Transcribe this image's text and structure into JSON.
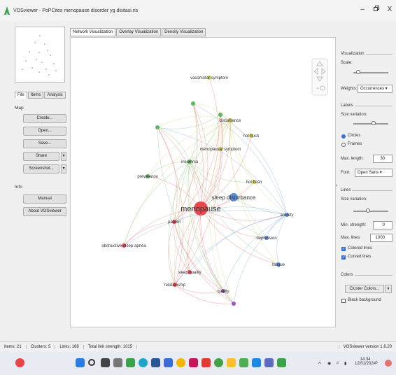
{
  "window": {
    "title": "VOSviewer - PoPCites menopause disorder yg disitasi.ris",
    "minimize": "–",
    "maximize": "料",
    "close": "X"
  },
  "left_panel": {
    "tabs": [
      "File",
      "Items",
      "Analysis"
    ],
    "map_label": "Map",
    "buttons": [
      "Create...",
      "Open...",
      "Save...",
      "Share",
      "Screenshot..."
    ],
    "info_label": "Info",
    "info_buttons": [
      "Manual",
      "About VOSviewer"
    ]
  },
  "main_tabs": [
    "Network Visualization",
    "Overlay Visualization",
    "Density Visualization"
  ],
  "right_panel": {
    "visualization": "Visualization",
    "scale": "Scale:",
    "weights_label": "Weights:",
    "weights_value": "Occurrences",
    "labels": "Labels",
    "size_variation": "Size variation:",
    "circles": "Circles",
    "frames": "Frames",
    "max_length_label": "Max. length:",
    "max_length_value": "30",
    "font_label": "Font:",
    "font_value": "Open Sans",
    "lines": "Lines",
    "lines_size_variation": "Size variation:",
    "min_strength_label": "Min. strength:",
    "min_strength_value": "0",
    "max_lines_label": "Max. lines:",
    "max_lines_value": "1000",
    "colored_lines": "Colored lines",
    "curved_lines": "Curved lines",
    "colors": "Colors",
    "cluster_colors": "Cluster Colors...",
    "black_background": "Black background"
  },
  "network": {
    "nodes": [
      {
        "id": "menopause",
        "label": "menopause",
        "color": "#e8474c",
        "size": "big"
      },
      {
        "id": "sleep disturbance",
        "label": "sleep disturbance",
        "color": "#5b8fd9",
        "size": "medium"
      },
      {
        "id": "vasomotor symptom",
        "label": "vasomotor symptom",
        "color": "#c9c94a"
      },
      {
        "id": "disturbance",
        "label": "disturbance",
        "color": "#c9c94a"
      },
      {
        "id": "hot flush",
        "label": "hot flush",
        "color": "#c9c94a"
      },
      {
        "id": "menopausal symptom",
        "label": "menopausal symptom",
        "color": "#c9c94a"
      },
      {
        "id": "insomnia",
        "label": "insomnia",
        "color": "#5cb85c"
      },
      {
        "id": "prevalence",
        "label": "prevalence",
        "color": "#5cb85c"
      },
      {
        "id": "hot flash",
        "label": "hot flash",
        "color": "#d9c94a"
      },
      {
        "id": "anxiety",
        "label": "anxiety",
        "color": "#5b8fd9"
      },
      {
        "id": "depression",
        "label": "depression",
        "color": "#5b8fd9"
      },
      {
        "id": "fatigue",
        "label": "fatigue",
        "color": "#5b8fd9"
      },
      {
        "id": "patient",
        "label": "patient",
        "color": "#e8474c"
      },
      {
        "id": "obstructive sleep apnea",
        "label": "obstructive sleep apnea",
        "color": "#e8474c"
      },
      {
        "id": "sleep quality",
        "label": "sleep quality",
        "color": "#e8474c"
      },
      {
        "id": "relationship",
        "label": "relationship",
        "color": "#e8474c"
      },
      {
        "id": "quality",
        "label": "quality",
        "color": "#9b59b6"
      },
      {
        "id": "unlabeled-1",
        "label": "",
        "color": "#5cb85c"
      },
      {
        "id": "unlabeled-2",
        "label": "",
        "color": "#5cb85c"
      },
      {
        "id": "unlabeled-3",
        "label": "",
        "color": "#9b59b6"
      },
      {
        "id": "unlabeled-4",
        "label": "",
        "color": "#5cb85c"
      }
    ]
  },
  "status": {
    "items": "Items: 21",
    "clusters": "Clusters: 5",
    "links": "Links: 168",
    "total_link_strength": "Total link strength: 1015",
    "version": "VOSviewer version 1.6.20"
  },
  "taskbar": {
    "time": "14.34",
    "date": "12/01/2024"
  }
}
